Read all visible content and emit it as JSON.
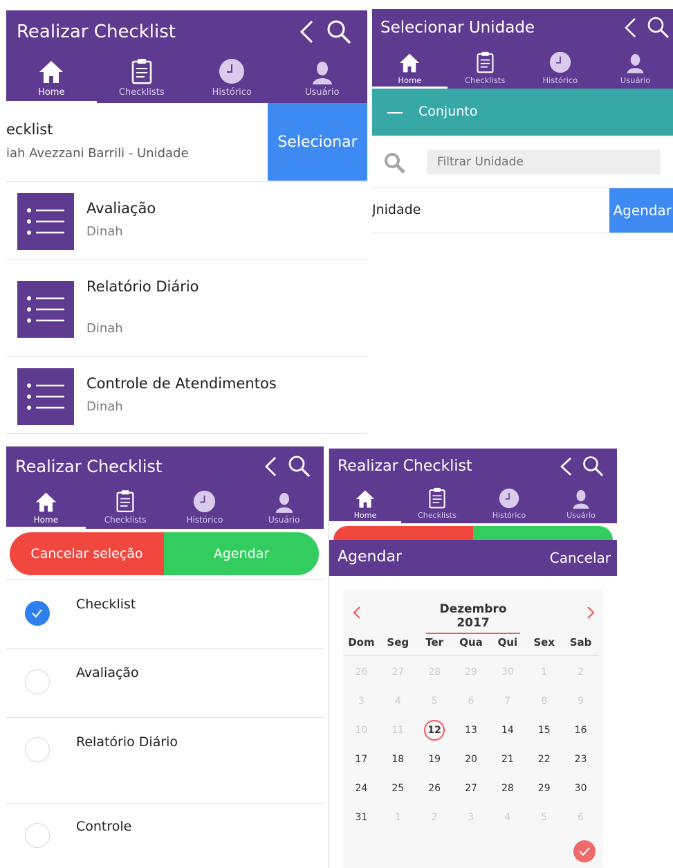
{
  "colors": {
    "primary": "#5e3a91",
    "teal": "#36a9a6",
    "blue": "#2f80ed",
    "red": "#f0473f",
    "green": "#33cc5f"
  },
  "tabs": [
    "Home",
    "Checklists",
    "Histórico",
    "Usuário"
  ],
  "panel_a": {
    "title": "Realizar Checklist",
    "header_title": "ecklist",
    "header_subtitle": "iah Avezzani Barrili - Unidade",
    "select_button": "Selecionar",
    "items": [
      {
        "title": "Avaliação",
        "subtitle": "Dinah"
      },
      {
        "title": "Relatório Diário",
        "subtitle": "Dinah"
      },
      {
        "title": "Controle de Atendimentos",
        "subtitle": "Dinah"
      }
    ]
  },
  "panel_b": {
    "title": "Selecionar Unidade",
    "group_label": "Conjunto",
    "filter_placeholder": "Filtrar Unidade",
    "unit_label": "Jnidade",
    "schedule_button": "Agendar"
  },
  "panel_c": {
    "title": "Realizar Checklist",
    "cancel_button": "Cancelar seleção",
    "schedule_button": "Agendar",
    "items": [
      {
        "label": "Checklist",
        "checked": true
      },
      {
        "label": "Avaliação",
        "checked": false
      },
      {
        "label": "Relatório Diário",
        "checked": false
      },
      {
        "label": "Controle",
        "checked": false
      }
    ]
  },
  "panel_d": {
    "title": "Realizar Checklist",
    "modal_title": "Agendar",
    "modal_cancel": "Cancelar",
    "month_label": "Dezembro 2017",
    "weekdays": [
      "Dom",
      "Seg",
      "Ter",
      "Qua",
      "Qui",
      "Sex",
      "Sab"
    ],
    "weeks": [
      [
        "26",
        "27",
        "28",
        "29",
        "30",
        "1",
        "2"
      ],
      [
        "3",
        "4",
        "5",
        "6",
        "7",
        "8",
        "9"
      ],
      [
        "10",
        "11",
        "12",
        "13",
        "14",
        "15",
        "16"
      ],
      [
        "17",
        "18",
        "19",
        "20",
        "21",
        "22",
        "23"
      ],
      [
        "24",
        "25",
        "26",
        "27",
        "28",
        "29",
        "30"
      ],
      [
        "31",
        "1",
        "2",
        "3",
        "4",
        "5",
        "6"
      ]
    ],
    "selected_day": "12"
  }
}
